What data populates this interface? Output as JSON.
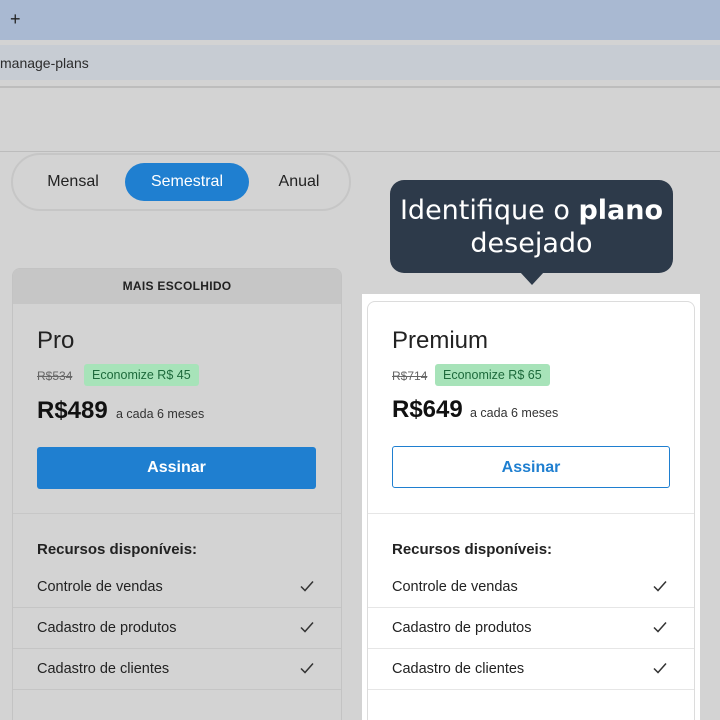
{
  "browser": {
    "newtab_symbol": "+",
    "url": "manage-plans"
  },
  "billing_toggle": {
    "options": [
      "Mensal",
      "Semestral",
      "Anual"
    ],
    "selected": "Semestral"
  },
  "tooltip": {
    "text_before": "Identifique o ",
    "text_bold": "plano",
    "text_after": "desejado"
  },
  "plans": [
    {
      "badge": "MAIS ESCOLHIDO",
      "name": "Pro",
      "old_price": "R$534",
      "savings": "Economize R$ 45",
      "price": "R$489",
      "period": "a cada 6 meses",
      "button": "Assinar",
      "features_title": "Recursos disponíveis:",
      "features": [
        "Controle de vendas",
        "Cadastro de produtos",
        "Cadastro de clientes"
      ]
    },
    {
      "name": "Premium",
      "old_price": "R$714",
      "savings": "Economize R$ 65",
      "price": "R$649",
      "period": "a cada 6 meses",
      "button": "Assinar",
      "features_title": "Recursos disponíveis:",
      "features": [
        "Controle de vendas",
        "Cadastro de produtos",
        "Cadastro de clientes"
      ]
    }
  ],
  "colors": {
    "accent": "#1f7fd0",
    "tooltip_bg": "#2d3a4a",
    "savings_bg": "#a7e3b9"
  }
}
